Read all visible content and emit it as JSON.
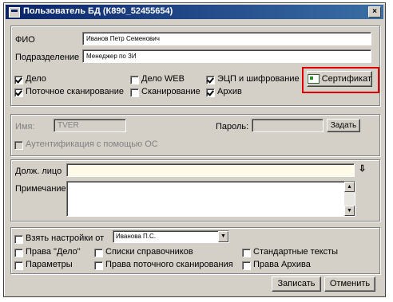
{
  "window": {
    "title": "Пользователь БД  (К890_52455654)",
    "close_glyph": "×"
  },
  "top": {
    "fio_label": "ФИО",
    "fio_value": "Иванов Петр Семенович",
    "dept_label": "Подразделение",
    "dept_value": "Менеджер по ЗИ"
  },
  "checks": {
    "delo": "Дело",
    "delo_web": "Дело WEB",
    "ecp": "ЭЦП и шифрование",
    "stream_scan": "Поточное сканирование",
    "scan": "Сканирование",
    "archive": "Архив"
  },
  "cert_button": "Сертификат",
  "auth": {
    "name_label": "Имя:",
    "name_value": "TVER",
    "password_label": "Пароль:",
    "set_button": "Задать",
    "os_auth_label": "Аутентификация с помощью ОС"
  },
  "position": {
    "label": "Долж. лицо",
    "value": "",
    "pick_glyph": "⇩"
  },
  "note": {
    "label": "Примечание",
    "value": ""
  },
  "settings": {
    "take_from_label": "Взять настройки от",
    "take_from_value": "Иванова П.С.",
    "rights_delo": "Права \"Дело\"",
    "lists": "Списки справочников",
    "std_texts": "Стандартные тексты",
    "params": "Параметры",
    "rights_stream": "Права поточного сканирования",
    "rights_archive": "Права Архива"
  },
  "buttons": {
    "save": "Записать",
    "cancel": "Отменить"
  }
}
